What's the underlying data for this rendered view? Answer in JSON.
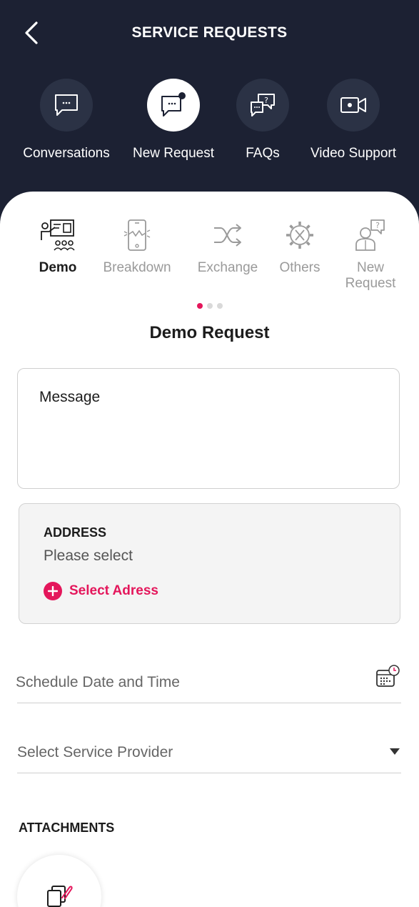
{
  "header": {
    "title": "SERVICE REQUESTS",
    "back_icon": "chevron-left-icon"
  },
  "top_actions": [
    {
      "label": "Conversations",
      "icon": "chat-bubble-icon",
      "active": false
    },
    {
      "label": "New Request",
      "icon": "chat-bubble-badge-icon",
      "active": true
    },
    {
      "label": "FAQs",
      "icon": "faq-bubbles-icon",
      "active": false
    },
    {
      "label": "Video Support",
      "icon": "video-camera-icon",
      "active": false
    }
  ],
  "categories": [
    {
      "label": "Demo",
      "icon": "presentation-icon",
      "active": true
    },
    {
      "label": "Breakdown",
      "icon": "broken-phone-icon",
      "active": false
    },
    {
      "label": "Exchange",
      "icon": "shuffle-icon",
      "active": false
    },
    {
      "label": "Others",
      "icon": "gear-tools-icon",
      "active": false
    },
    {
      "label": "New Request",
      "icon": "person-question-icon",
      "active": false
    }
  ],
  "pager": {
    "count": 3,
    "current": 0
  },
  "form": {
    "title": "Demo Request",
    "message_placeholder": "Message",
    "address": {
      "heading": "ADDRESS",
      "placeholder": "Please select",
      "link_label": "Select Adress"
    },
    "schedule_placeholder": "Schedule Date and Time",
    "provider_placeholder": "Select Service Provider",
    "attachments_heading": "ATTACHMENTS"
  },
  "colors": {
    "header_bg": "#1c2133",
    "accent": "#e4165b",
    "circle_bg": "#2b3245"
  }
}
